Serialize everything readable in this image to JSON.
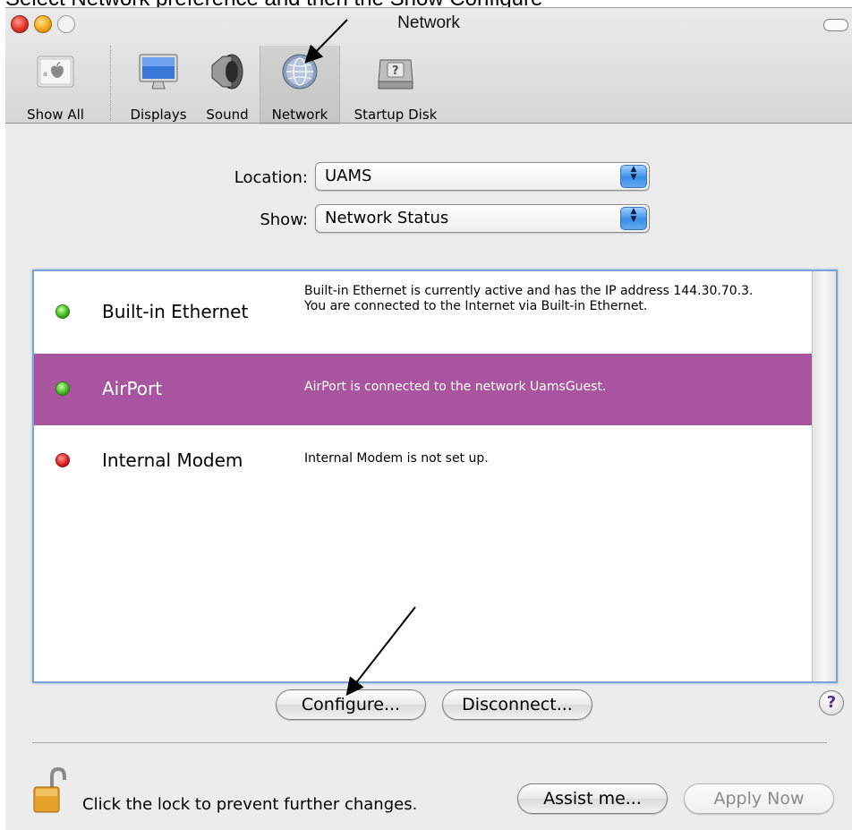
{
  "caption": "Select Network preference and then the Show Configure",
  "window": {
    "title": "Network"
  },
  "toolbar": {
    "items": [
      {
        "label": "Show All"
      },
      {
        "label": "Displays"
      },
      {
        "label": "Sound"
      },
      {
        "label": "Network"
      },
      {
        "label": "Startup Disk"
      }
    ],
    "selected": "Network"
  },
  "form": {
    "location_label": "Location:",
    "location_value": "UAMS",
    "show_label": "Show:",
    "show_value": "Network Status"
  },
  "services": [
    {
      "name": "Built-in Ethernet",
      "status_color": "#38b21a",
      "description": "Built-in Ethernet is currently active and has the IP address 144.30.70.3. You are connected to the Internet via Built-in Ethernet."
    },
    {
      "name": "AirPort",
      "status_color": "#38b21a",
      "description": "AirPort is connected to the network UamsGuest.",
      "selected": true
    },
    {
      "name": "Internal Modem",
      "status_color": "#d81a1a",
      "description": "Internal Modem is not set up."
    }
  ],
  "buttons": {
    "configure": "Configure...",
    "disconnect": "Disconnect...",
    "help": "?",
    "assist": "Assist me...",
    "apply": "Apply Now"
  },
  "lock": {
    "text": "Click the lock to prevent further changes."
  },
  "colors": {
    "selected_row": "#a9549e",
    "focus_ring": "#7aa4d6"
  },
  "icons": [
    "apple-logo-icon",
    "displays-icon",
    "speaker-icon",
    "network-globe-icon",
    "startup-disk-icon",
    "lock-open-icon",
    "help-icon"
  ]
}
